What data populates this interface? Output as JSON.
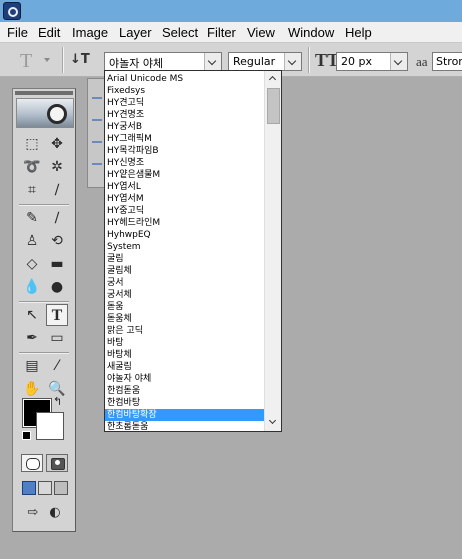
{
  "menubar": {
    "items": [
      "File",
      "Edit",
      "Image",
      "Layer",
      "Select",
      "Filter",
      "View",
      "Window",
      "Help"
    ]
  },
  "options": {
    "tool_preset_glyph": "T",
    "font_family_value": "야놀자 야체",
    "font_style_value": "Regular",
    "font_size_value": "20 px",
    "antialias_glyph": "aa",
    "antialias_value": "Strong"
  },
  "font_dropdown": {
    "items": [
      "Arial Unicode MS",
      "Fixedsys",
      "HY견고딕",
      "HY견명조",
      "HY궁서B",
      "HY그래픽M",
      "HY목각파임B",
      "HY신명조",
      "HY얕은샘물M",
      "HY엽서L",
      "HY엽서M",
      "HY중고딕",
      "HY헤드라인M",
      "HyhwpEQ",
      "System",
      "굴림",
      "굴림체",
      "궁서",
      "궁서체",
      "돋움",
      "돋움체",
      "맑은 고딕",
      "바탕",
      "바탕체",
      "새굴림",
      "야놀자 야체",
      "한컴돋움",
      "한컴바탕",
      "한컴바탕확장",
      "한초롬돋움"
    ],
    "highlighted_index": 28
  },
  "toolbox": {
    "foreground_color": "#000000",
    "background_color": "#ffffff"
  }
}
